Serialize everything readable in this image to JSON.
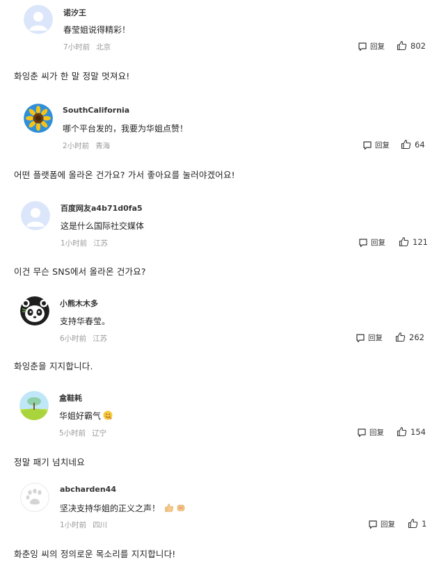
{
  "reply_label": "回复",
  "comments": [
    {
      "username": "诺汐王",
      "text": "春莹姐说得精彩！",
      "time": "7小时前",
      "location": "北京",
      "likes": "802",
      "translation": "화잉춘 씨가 한 말 정말 멋져요!"
    },
    {
      "username": "SouthCalifornia",
      "text": "哪个平台发的，我要为华姐点赞！",
      "time": "2小时前",
      "location": "青海",
      "likes": "64",
      "translation": "어떤 플랫폼에 올라온 건가요? 가서 좋아요를 눌러야겠어요!"
    },
    {
      "username": "百度网友a4b71d0fa5",
      "text": "这是什么国际社交媒体",
      "time": "1小时前",
      "location": "江苏",
      "likes": "121",
      "translation": "이건 무슨 SNS에서 올라온 건가요?"
    },
    {
      "username": "小熊木木多",
      "text": "支持华春莹。",
      "time": "6小时前",
      "location": "江苏",
      "likes": "262",
      "translation": "화잉춘을 지지합니다."
    },
    {
      "username": "盒鞋耗",
      "text": "华姐好霸气",
      "time": "5小时前",
      "location": "辽宁",
      "likes": "154",
      "translation": "정말 패기 넘치네요"
    },
    {
      "username": "abcharden44",
      "text": "坚决支持华姐的正义之声！",
      "time": "1小时前",
      "location": "四川",
      "likes": "1",
      "translation": "화춘잉 씨의 정의로운 목소리를 지지합니다!"
    }
  ]
}
